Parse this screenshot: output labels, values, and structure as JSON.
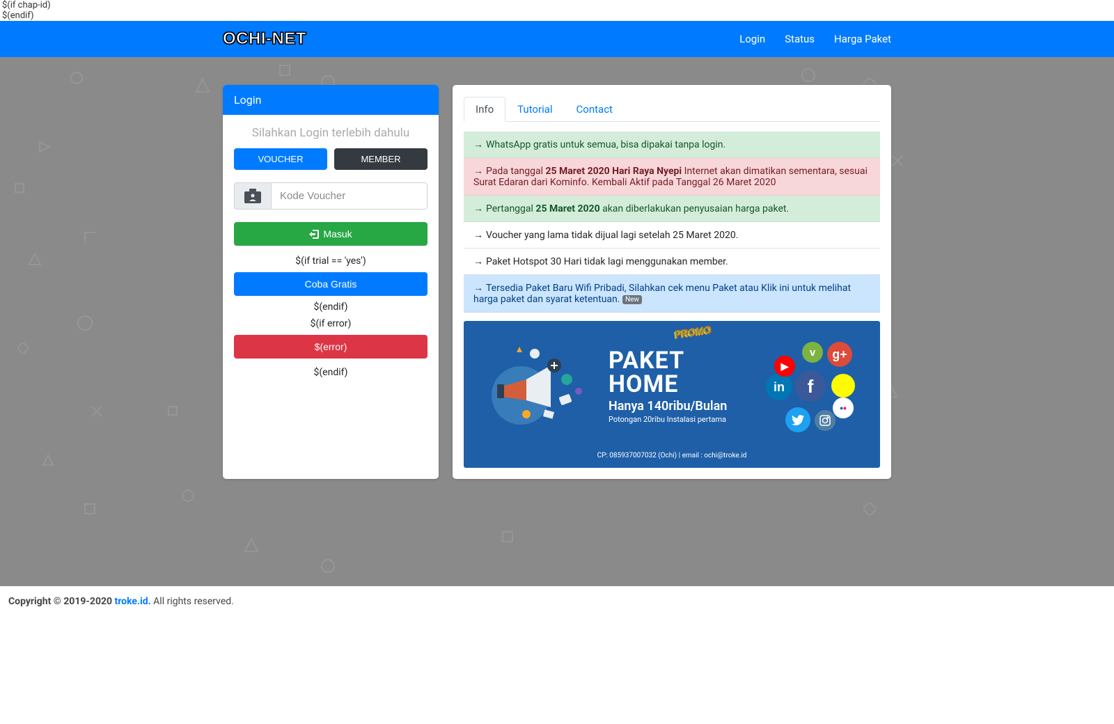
{
  "template_lines": {
    "l1": "$(if chap-id)",
    "l2": "$(endif)"
  },
  "brand": "OCHI-NET",
  "nav": {
    "login": "Login",
    "status": "Status",
    "harga": "Harga Paket"
  },
  "login": {
    "header": "Login",
    "subtitle": "Silahkan Login terlebih dahulu",
    "tab_voucher": "VOUCHER",
    "tab_member": "MEMBER",
    "placeholder": "Kode Voucher",
    "masuk": "Masuk",
    "trial_if": "$(if trial == 'yes')",
    "coba": "Coba Gratis",
    "endif1": "$(endif)",
    "if_error": "$(if error)",
    "error": "$(error)",
    "endif2": "$(endif)"
  },
  "tabs": {
    "info": "Info",
    "tutorial": "Tutorial",
    "contact": "Contact"
  },
  "notices": {
    "n1": "WhatsApp gratis untuk semua, bisa dipakai tanpa login.",
    "n2a": "Pada tanggal ",
    "n2b": "25 Maret 2020 Hari Raya Nyepi",
    "n2c": " Internet akan dimatikan sementara, sesuai Surat Edaran dari Kominfo. Kembali Aktif pada Tanggal 26 Maret 2020",
    "n3a": "Pertanggal ",
    "n3b": "25 Maret 2020",
    "n3c": " akan diberlakukan penyusaian harga paket.",
    "n4": "Voucher yang lama tidak dijual lagi setelah 25 Maret 2020.",
    "n5": "Paket Hotspot 30 Hari tidak lagi menggunakan member.",
    "n6a": "Tersedia Paket Baru Wifi Pribadi, Silahkan cek menu Paket atau ",
    "n6b": "Klik ini untuk melihat harga paket dan syarat ketentuan.",
    "new": "New"
  },
  "banner": {
    "promo": "PROMO",
    "title": "PAKET HOME",
    "sub1": "Hanya 140ribu/Bulan",
    "sub2": "Potongan 20ribu Instalasi pertama",
    "foot": "CP: 085937007032 (Ochi)  |  email : ochi@troke.id"
  },
  "footer": {
    "copy": "Copyright © 2019-2020 ",
    "link": "troke.id.",
    "rights": " All rights reserved."
  }
}
